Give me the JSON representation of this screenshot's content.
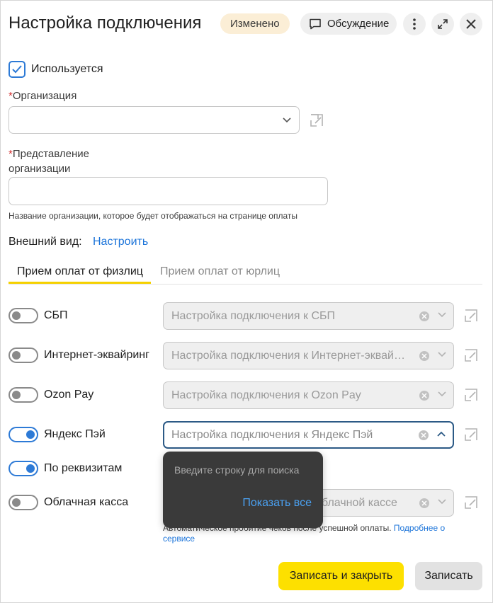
{
  "header": {
    "title": "Настройка подключения",
    "badge": "Изменено",
    "discuss_label": "Обсуждение"
  },
  "used": {
    "label": "Используется",
    "checked": true
  },
  "organization": {
    "label": "Организация",
    "required_mark": "*",
    "value": ""
  },
  "org_display": {
    "label_line1": "Представление",
    "label_line2": "организации",
    "required_mark": "*",
    "value": "",
    "hint": "Название организации, которое будет отображаться на странице оплаты"
  },
  "appearance": {
    "label": "Внешний вид:",
    "link": "Настроить"
  },
  "tabs": [
    {
      "label": "Прием оплат от физлиц",
      "active": true
    },
    {
      "label": "Прием оплат от юрлиц",
      "active": false
    }
  ],
  "methods": [
    {
      "label": "СБП",
      "enabled": false,
      "select_text": "Настройка подключения к СБП"
    },
    {
      "label": "Интернет-эквайринг",
      "enabled": false,
      "select_text": "Настройка подключения к Интернет-эквайрингу"
    },
    {
      "label": "Ozon Pay",
      "enabled": false,
      "select_text": "Настройка подключения к Ozon Pay"
    },
    {
      "label": "Яндекс Пэй",
      "enabled": true,
      "select_text": "Настройка подключения к Яндекс Пэй"
    },
    {
      "label": "По реквизитам",
      "enabled": true
    },
    {
      "label": "Облачная касса",
      "enabled": false,
      "select_text_visible": "блачной кассе"
    }
  ],
  "popup": {
    "search_placeholder": "Введите строку для поиска",
    "show_all": "Показать все"
  },
  "cloud_note": {
    "text": "Автоматическое пробитие чеков после успешной оплаты.",
    "link": "Подробнее о",
    "link2": "сервисе"
  },
  "footer": {
    "save_close": "Записать и закрыть",
    "save": "Записать"
  },
  "colors": {
    "accent": "#2d7ad6",
    "primary_button": "#fde000",
    "tab_underline": "#f5d100",
    "badge_bg": "#fbeed6"
  }
}
